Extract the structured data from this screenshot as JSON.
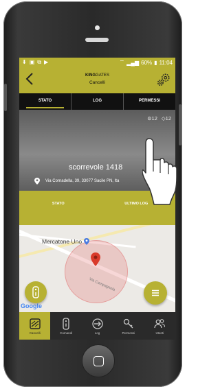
{
  "statusbar": {
    "left_icons": [
      "download-icon",
      "image-icon",
      "copy-icon",
      "play-icon"
    ],
    "battery": "60%",
    "time": "11:04"
  },
  "header": {
    "brand_bold": "KING",
    "brand_light": "GATES",
    "title": "Cancelli"
  },
  "tabs": [
    {
      "label": "STATO",
      "active": true
    },
    {
      "label": "LOG",
      "active": false
    },
    {
      "label": "PERMESSI",
      "active": false
    }
  ],
  "gate": {
    "users_count": "12",
    "keys_count": "12",
    "name": "scorrevole 1418",
    "address": "Via Cornadella, 39, 33077 Sacile PN, Ita"
  },
  "olive_bar": {
    "left_label": "STATO",
    "right_label": "ULTIMO LOG"
  },
  "map": {
    "place_label": "Mercatone Uno",
    "street_label": "Via Campagnola",
    "attribution": "Google"
  },
  "bottom_nav": [
    {
      "label": "Cancelli",
      "icon": "gate-icon",
      "active": true
    },
    {
      "label": "Comandi",
      "icon": "remote-icon",
      "active": false
    },
    {
      "label": "Log",
      "icon": "log-icon",
      "active": false
    },
    {
      "label": "Permessi",
      "icon": "key-icon",
      "active": false
    },
    {
      "label": "Utenti",
      "icon": "users-icon",
      "active": false
    }
  ],
  "colors": {
    "accent": "#b7b133",
    "tabbar": "#111111",
    "nav": "#2a2a2a"
  }
}
